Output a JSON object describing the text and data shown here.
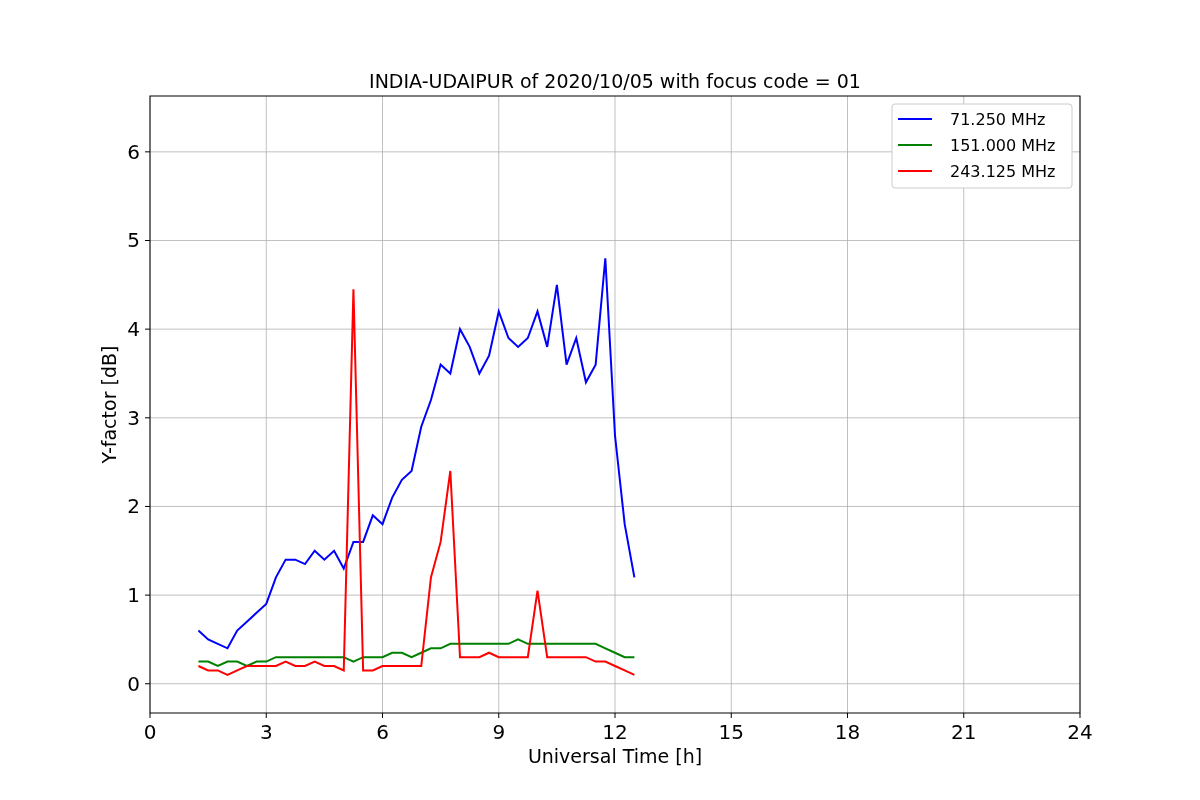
{
  "chart_data": {
    "type": "line",
    "title": "INDIA-UDAIPUR of 2020/10/05 with focus code = 01",
    "xlabel": "Universal Time [h]",
    "ylabel": "Y-factor [dB]",
    "x": [
      1.25,
      1.5,
      1.75,
      2.0,
      2.25,
      2.5,
      2.75,
      3.0,
      3.25,
      3.5,
      3.75,
      4.0,
      4.25,
      4.5,
      4.75,
      5.0,
      5.25,
      5.5,
      5.75,
      6.0,
      6.25,
      6.5,
      6.75,
      7.0,
      7.25,
      7.5,
      7.75,
      8.0,
      8.25,
      8.5,
      8.75,
      9.0,
      9.25,
      9.5,
      9.75,
      10.0,
      10.25,
      10.5,
      10.75,
      11.0,
      11.25,
      11.5,
      11.75,
      12.0,
      12.25,
      12.5
    ],
    "series": [
      {
        "name": "71.250 MHz",
        "color": "#0000ff",
        "values": [
          0.6,
          0.5,
          0.45,
          0.4,
          0.6,
          0.7,
          0.8,
          0.9,
          1.2,
          1.4,
          1.4,
          1.35,
          1.5,
          1.4,
          1.5,
          1.3,
          1.6,
          1.6,
          1.9,
          1.8,
          2.1,
          2.3,
          2.4,
          2.9,
          3.2,
          3.6,
          3.5,
          4.0,
          3.8,
          3.5,
          3.7,
          4.2,
          3.9,
          3.8,
          3.9,
          4.2,
          3.8,
          4.5,
          3.6,
          3.9,
          3.4,
          3.6,
          4.8,
          2.8,
          1.8,
          1.2
        ]
      },
      {
        "name": "151.000 MHz",
        "color": "#008000",
        "values": [
          0.25,
          0.25,
          0.2,
          0.25,
          0.25,
          0.2,
          0.25,
          0.25,
          0.3,
          0.3,
          0.3,
          0.3,
          0.3,
          0.3,
          0.3,
          0.3,
          0.25,
          0.3,
          0.3,
          0.3,
          0.35,
          0.35,
          0.3,
          0.35,
          0.4,
          0.4,
          0.45,
          0.45,
          0.45,
          0.45,
          0.45,
          0.45,
          0.45,
          0.5,
          0.45,
          0.45,
          0.45,
          0.45,
          0.45,
          0.45,
          0.45,
          0.45,
          0.4,
          0.35,
          0.3,
          0.3
        ]
      },
      {
        "name": "243.125 MHz",
        "color": "#ff0000",
        "values": [
          0.2,
          0.15,
          0.15,
          0.1,
          0.15,
          0.2,
          0.2,
          0.2,
          0.2,
          0.25,
          0.2,
          0.2,
          0.25,
          0.2,
          0.2,
          0.15,
          4.45,
          0.15,
          0.15,
          0.2,
          0.2,
          0.2,
          0.2,
          0.2,
          1.2,
          1.6,
          2.4,
          0.3,
          0.3,
          0.3,
          0.35,
          0.3,
          0.3,
          0.3,
          0.3,
          1.05,
          0.3,
          0.3,
          0.3,
          0.3,
          0.3,
          0.25,
          0.25,
          0.2,
          0.15,
          0.1
        ]
      }
    ],
    "grid": true,
    "legend": true,
    "xlim": [
      0,
      24
    ],
    "ylim": [
      -0.33,
      6.63
    ],
    "xticks": [
      0,
      3,
      6,
      9,
      12,
      15,
      18,
      21,
      24
    ],
    "yticks": [
      0,
      1,
      2,
      3,
      4,
      5,
      6
    ]
  }
}
